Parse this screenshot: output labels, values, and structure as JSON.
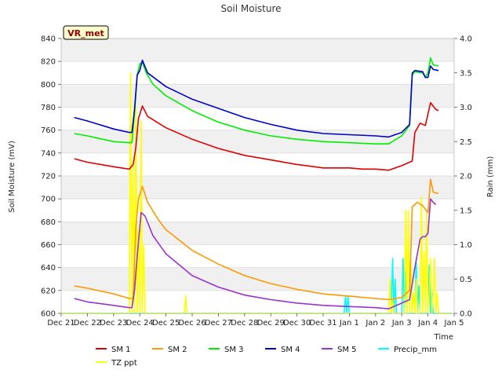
{
  "chart_data": {
    "type": "line",
    "title": "Soil Moisture",
    "badge": "VR_met",
    "xlabel": "Time",
    "ylabel": "Soil Moisture (mV)",
    "y2label": "Rain (mm)",
    "ylim": [
      600,
      840
    ],
    "y2lim": [
      0,
      4.0
    ],
    "xlim": [
      0,
      15
    ],
    "x_ticks": [
      {
        "x": 0,
        "label": "Dec 21"
      },
      {
        "x": 1,
        "label": "Dec 22"
      },
      {
        "x": 2,
        "label": "Dec 23"
      },
      {
        "x": 3,
        "label": "Dec 24"
      },
      {
        "x": 4,
        "label": "Dec 25"
      },
      {
        "x": 5,
        "label": "Dec 26"
      },
      {
        "x": 6,
        "label": "Dec 27"
      },
      {
        "x": 7,
        "label": "Dec 28"
      },
      {
        "x": 8,
        "label": "Dec 29"
      },
      {
        "x": 9,
        "label": "Dec 30"
      },
      {
        "x": 10,
        "label": "Dec 31"
      },
      {
        "x": 11,
        "label": "Jan 1"
      },
      {
        "x": 12,
        "label": "Jan 2"
      },
      {
        "x": 13,
        "label": "Jan 3"
      },
      {
        "x": 14,
        "label": "Jan 4"
      },
      {
        "x": 15,
        "label": "Jan 5"
      }
    ],
    "y_ticks": [
      "600",
      "620",
      "640",
      "660",
      "680",
      "700",
      "720",
      "740",
      "760",
      "780",
      "800",
      "820",
      "840"
    ],
    "y2_ticks": [
      "0.0",
      "0.5",
      "1.0",
      "1.5",
      "2.0",
      "2.5",
      "3.0",
      "3.5",
      "4.0"
    ],
    "grid": "horizontal bands",
    "legend_position": "bottom",
    "series": [
      {
        "name": "SM 1",
        "color": "#dd0000",
        "axis": "left",
        "x": [
          0.5,
          1,
          2,
          2.6,
          2.75,
          2.85,
          2.95,
          3.1,
          3.3,
          4,
          5,
          6,
          7,
          8,
          9,
          10,
          11,
          11.5,
          12,
          12.5,
          13,
          13.4,
          13.5,
          13.7,
          13.9,
          14.1,
          14.3,
          14.4
        ],
        "y": [
          735,
          732,
          728,
          726,
          730,
          745,
          770,
          781,
          772,
          762,
          752,
          744,
          738,
          734,
          730,
          727,
          727,
          726,
          726,
          725,
          729,
          733,
          758,
          766,
          764,
          784,
          778,
          777
        ]
      },
      {
        "name": "SM 2",
        "color": "#ff9900",
        "axis": "left",
        "x": [
          0.5,
          1,
          2,
          2.6,
          2.75,
          2.85,
          2.95,
          3.1,
          3.3,
          3.7,
          4,
          5,
          6,
          7,
          8,
          9,
          10,
          11,
          12,
          12.5,
          13,
          13.3,
          13.4,
          13.6,
          13.8,
          14,
          14.1,
          14.2,
          14.3,
          14.4
        ],
        "y": [
          624,
          622,
          617,
          613,
          613,
          675,
          700,
          711,
          697,
          682,
          673,
          655,
          643,
          633,
          626,
          621,
          617,
          615,
          613,
          612,
          614,
          620,
          693,
          697,
          694,
          688,
          717,
          706,
          705,
          705
        ]
      },
      {
        "name": "SM 3",
        "color": "#00ee00",
        "axis": "left",
        "x": [
          0.5,
          1,
          2,
          2.6,
          2.7,
          2.8,
          2.9,
          3.0,
          3.1,
          3.25,
          3.5,
          4,
          5,
          6,
          7,
          8,
          9,
          10,
          11,
          12,
          12.5,
          13,
          13.3,
          13.4,
          13.5,
          13.8,
          13.9,
          14.0,
          14.1,
          14.2,
          14.4
        ],
        "y": [
          757,
          755,
          750,
          749,
          749,
          775,
          808,
          818,
          819,
          810,
          800,
          790,
          777,
          767,
          760,
          755,
          752,
          750,
          749,
          748,
          748,
          755,
          764,
          808,
          811,
          810,
          806,
          810,
          823,
          817,
          816
        ]
      },
      {
        "name": "SM 4",
        "color": "#0000cc",
        "axis": "left",
        "x": [
          0.5,
          1,
          2,
          2.6,
          2.7,
          2.8,
          2.9,
          3.0,
          3.1,
          3.3,
          4,
          5,
          6,
          7,
          8,
          9,
          10,
          11,
          12,
          12.5,
          13,
          13.3,
          13.4,
          13.5,
          13.8,
          13.9,
          14.0,
          14.1,
          14.2,
          14.4
        ],
        "y": [
          771,
          768,
          761,
          758,
          758,
          778,
          808,
          812,
          821,
          810,
          798,
          787,
          779,
          771,
          765,
          760,
          757,
          756,
          755,
          754,
          758,
          765,
          810,
          812,
          811,
          806,
          806,
          816,
          813,
          812
        ]
      },
      {
        "name": "SM 5",
        "color": "#9933cc",
        "axis": "left",
        "x": [
          0.5,
          1,
          2,
          2.6,
          2.7,
          2.8,
          2.9,
          3.05,
          3.2,
          3.5,
          4,
          5,
          6,
          7,
          8,
          9,
          10,
          11,
          12,
          12.5,
          13,
          13.3,
          13.5,
          13.7,
          13.8,
          13.9,
          14.0,
          14.1,
          14.2,
          14.3
        ],
        "y": [
          613,
          610,
          607,
          605,
          605,
          620,
          650,
          688,
          685,
          668,
          652,
          633,
          623,
          616,
          612,
          609,
          607,
          606,
          605,
          604,
          609,
          612,
          640,
          665,
          667,
          667,
          670,
          700,
          697,
          695
        ]
      },
      {
        "name": "Precip_mm",
        "color": "#00ffff",
        "axis": "right",
        "x": [
          0,
          10.8,
          10.85,
          10.9,
          10.95,
          11.0,
          12.6,
          12.65,
          12.7,
          12.75,
          12.8,
          13.0,
          13.05,
          13.1,
          13.15,
          13.2,
          13.5,
          13.55,
          13.6,
          13.65,
          13.7,
          14.0,
          14.05,
          14.1,
          14.15,
          14.2,
          14.9
        ],
        "y": [
          0,
          0,
          0.25,
          0,
          0.25,
          0,
          0,
          0.8,
          0,
          0.5,
          0,
          0,
          0.8,
          0,
          0.6,
          0,
          0,
          0.8,
          0,
          0.4,
          0,
          0,
          0.7,
          0,
          0.3,
          0,
          0
        ]
      },
      {
        "name": "TZ ppt",
        "color": "#ffff00",
        "axis": "right",
        "x": [
          0,
          2.6,
          2.65,
          2.7,
          2.75,
          2.8,
          2.85,
          2.9,
          2.95,
          3.0,
          3.05,
          3.1,
          3.15,
          3.2,
          4.7,
          4.75,
          4.8,
          4.85,
          12.5,
          12.55,
          12.6,
          12.65,
          12.7,
          13.1,
          13.15,
          13.2,
          13.25,
          13.3,
          13.35,
          13.4,
          13.45,
          13.5,
          13.55,
          13.6,
          13.7,
          13.75,
          13.8,
          13.85,
          13.9,
          13.95,
          14.0,
          14.05,
          14.1,
          14.15,
          14.2,
          14.25,
          14.3,
          14.35,
          14.4,
          14.9
        ],
        "y": [
          0,
          0,
          3.5,
          0,
          2.2,
          0,
          3.0,
          0,
          1.2,
          0,
          2.8,
          0,
          1.0,
          0,
          0,
          0.25,
          0,
          0,
          0,
          0.5,
          0,
          0.2,
          0,
          0,
          1.5,
          0,
          1.5,
          0,
          0.8,
          0,
          0.3,
          0,
          0.5,
          0,
          0,
          1.7,
          0,
          0.9,
          0,
          1.5,
          0,
          0.3,
          0.8,
          0,
          0.3,
          0.8,
          0,
          0.3,
          0,
          0
        ]
      }
    ]
  }
}
